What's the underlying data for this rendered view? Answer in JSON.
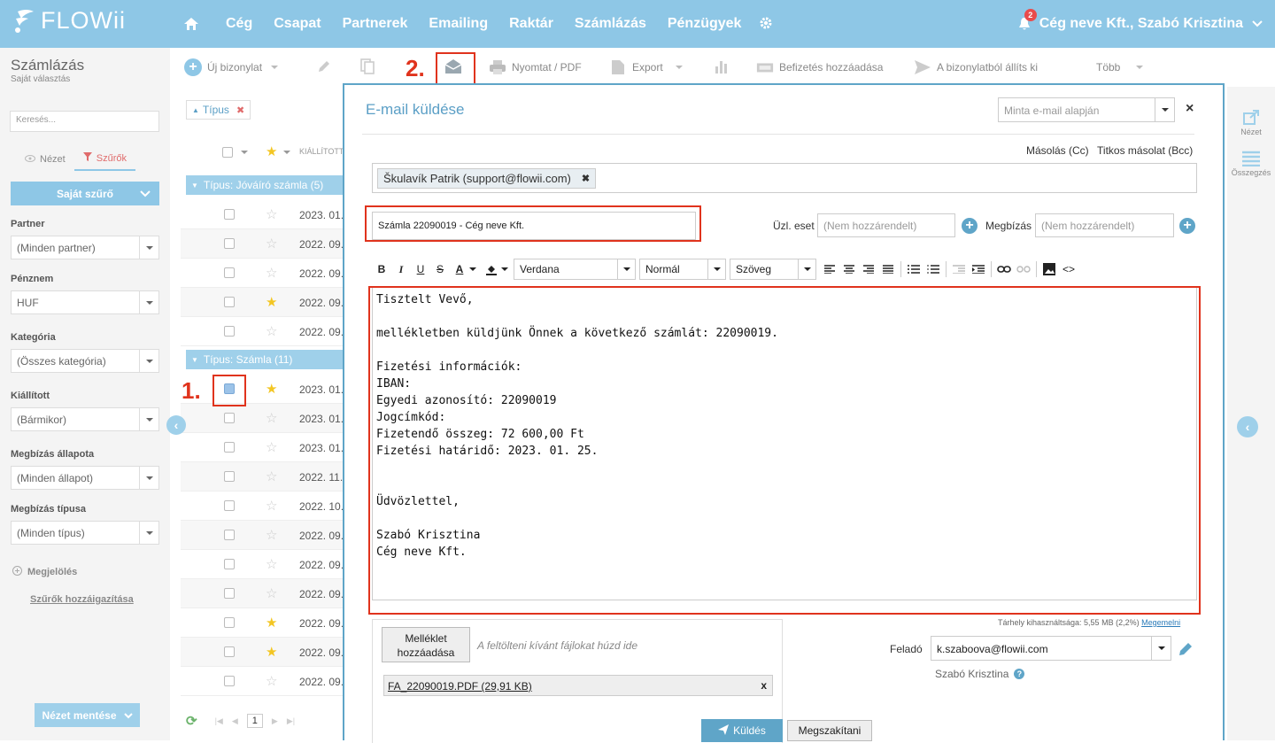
{
  "brand": {
    "name": "FLOWii"
  },
  "nav": {
    "items": [
      "Cég",
      "Csapat",
      "Partnerek",
      "Emailing",
      "Raktár",
      "Számlázás",
      "Pénzügyek"
    ]
  },
  "user": {
    "label": "Cég neve Kft., Szabó Krisztina",
    "notifications": "2"
  },
  "sidebar": {
    "title": "Számlázás",
    "subtitle": "Saját választás",
    "search_placeholder": "Keresés...",
    "tab_view": "Nézet",
    "tab_filters": "Szűrők",
    "own_filter": "Saját szűrő",
    "filters": [
      {
        "label": "Partner",
        "value": "(Minden partner)"
      },
      {
        "label": "Pénznem",
        "value": "HUF"
      },
      {
        "label": "Kategória",
        "value": "(Összes kategória)"
      },
      {
        "label": "Kiállított",
        "value": "(Bármikor)"
      },
      {
        "label": "Megbízás állapota",
        "value": "(Minden állapot)"
      },
      {
        "label": "Megbízás típusa",
        "value": "(Minden típus)"
      }
    ],
    "marking": "Megjelölés",
    "assign_filters": "Szűrők hozzáigazítása",
    "save_view": "Nézet mentése"
  },
  "toolbar": {
    "new_doc": "Új bizonylat",
    "print": "Nyomtat / PDF",
    "export": "Export",
    "add_payment": "Befizetés hozzáadása",
    "create_from": "A bizonylatból állíts ki",
    "more": "Több"
  },
  "list": {
    "filter_chip": "Típus",
    "col_issued": "KIÁLLÍTOTT",
    "groups": [
      "Típus: Jóváíró számla (5)",
      "Típus: Számla (11)"
    ],
    "rows_group1": [
      {
        "date": "2023. 01.",
        "star": false
      },
      {
        "date": "2022. 09.",
        "star": false
      },
      {
        "date": "2022. 09.",
        "star": false
      },
      {
        "date": "2022. 09.",
        "star": true
      },
      {
        "date": "2022. 09.",
        "star": false
      }
    ],
    "rows_group2": [
      {
        "date": "2023. 01.",
        "star": true,
        "checked": true
      },
      {
        "date": "2023. 01.",
        "star": false
      },
      {
        "date": "2023. 01.",
        "star": false
      },
      {
        "date": "2022. 11.",
        "star": false
      },
      {
        "date": "2022. 10.",
        "star": false
      },
      {
        "date": "2022. 09.",
        "star": false
      },
      {
        "date": "2022. 09.",
        "star": false
      },
      {
        "date": "2022. 09.",
        "star": false
      },
      {
        "date": "2022. 09.",
        "star": true
      },
      {
        "date": "2022. 09.",
        "star": true
      },
      {
        "date": "2022. 09.",
        "star": false
      }
    ],
    "page": "1"
  },
  "modal": {
    "title": "E-mail küldése",
    "template_placeholder": "Minta e-mail alapján",
    "cc_label": "Másolás (Cc)",
    "bcc_label": "Titkos másolat (Bcc)",
    "recipient": "Škulavík Patrik (support@flowii.com)",
    "subject": "Számla 22090019 - Cég neve Kft.",
    "case_label": "Üzl. eset",
    "case_placeholder": "(Nem hozzárendelt)",
    "order_label": "Megbízás",
    "order_placeholder": "(Nem hozzárendelt)",
    "font": "Verdana",
    "size": "Normál",
    "format": "Szöveg",
    "body": "Tisztelt Vevő,\n\nmellékletben küldjünk Önnek a következő számlát: 22090019.\n\nFizetési információk:\nIBAN:\nEgyedi azonosító: 22090019\nJogcímkód:\nFizetendő összeg: 72 600,00 Ft\nFizetési határidő: 2023. 01. 25.\n\n\nÜdvözlettel,\n\nSzabó Krisztina\nCég neve Kft.",
    "quota_text": "Tárhely kihasználtsága: 5,55 MB (2,2%)",
    "quota_link": "Megemelni",
    "attach_btn": "Melléklet hozzáadása",
    "attach_hint": "A feltölteni kívánt fájlokat húzd ide",
    "attachment": "FA_22090019.PDF (29,91 KB)",
    "from_label": "Feladó",
    "from_email": "k.szaboova@flowii.com",
    "from_name": "Szabó Krisztina",
    "send": "Küldés",
    "cancel": "Megszakítani"
  },
  "rightpane": {
    "view": "Nézet",
    "summary": "Összegzés"
  },
  "annotations": {
    "step1": "1.",
    "step2": "2."
  },
  "colors": {
    "topbar": "#8ec7e6",
    "accent": "#5fa5c8",
    "highlight": "#e0331d"
  }
}
